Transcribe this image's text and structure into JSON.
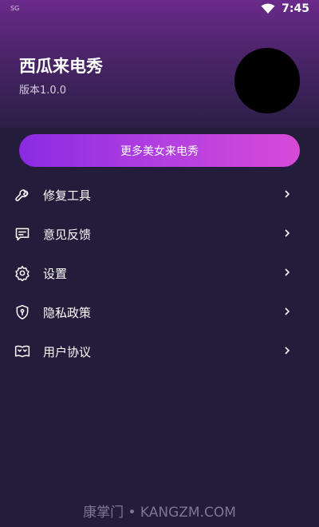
{
  "status_bar": {
    "carrier": "SG",
    "time": "7:45"
  },
  "header": {
    "title": "西瓜来电秀",
    "version": "版本1.0.0"
  },
  "promo_button": {
    "label": "更多美女来电秀"
  },
  "menu": {
    "items": [
      {
        "label": "修复工具",
        "icon": "wrench-icon"
      },
      {
        "label": "意见反馈",
        "icon": "feedback-icon"
      },
      {
        "label": "设置",
        "icon": "gear-icon"
      },
      {
        "label": "隐私政策",
        "icon": "shield-icon"
      },
      {
        "label": "用户协议",
        "icon": "book-icon"
      }
    ]
  },
  "watermark": {
    "text": "康掌门 • KANGZM.COM"
  },
  "colors": {
    "background": "#241c3b",
    "header_gradient_top": "#6a2a8a",
    "button_gradient_start": "#8a2be2",
    "button_gradient_end": "#d84ad8"
  }
}
